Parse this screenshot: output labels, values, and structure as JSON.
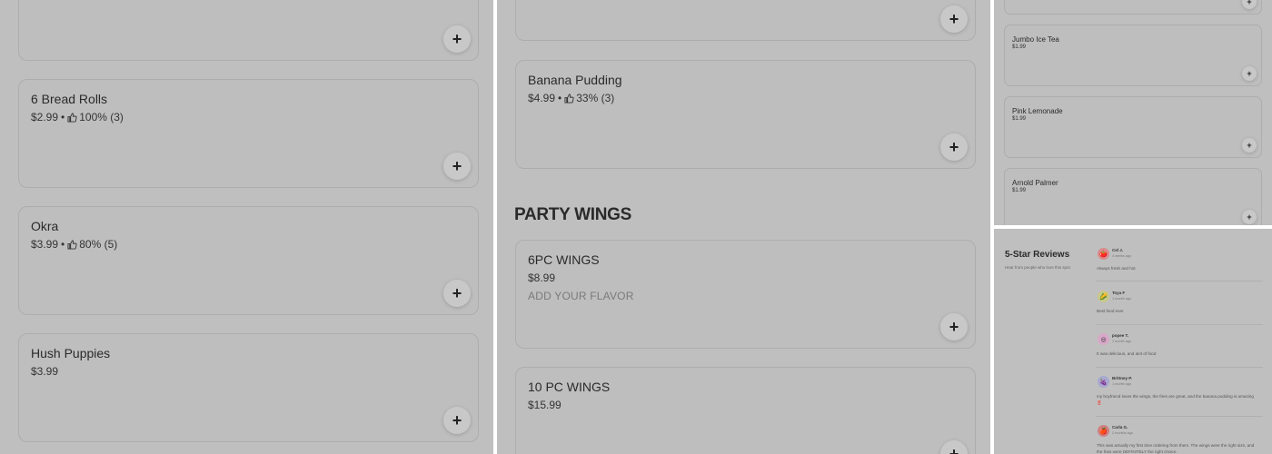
{
  "colors": {
    "panel_bg": "#bfbfbf",
    "card_border": "#adadad",
    "plus_bg": "#c8c8c8"
  },
  "panel1": {
    "items": [
      {
        "title": "",
        "price": ""
      },
      {
        "title": "6 Bread Rolls",
        "price": "$2.99",
        "rating": "100% (3)"
      },
      {
        "title": "Okra",
        "price": "$3.99",
        "rating": "80% (5)"
      },
      {
        "title": "Hush Puppies",
        "price": "$3.99"
      }
    ]
  },
  "panel2": {
    "items": [
      {
        "title": "",
        "price": ""
      },
      {
        "title": "Banana Pudding",
        "price": "$4.99",
        "rating": "33% (3)"
      }
    ],
    "section_title": "PARTY WINGS",
    "wings": [
      {
        "title": "6PC WINGS",
        "price": "$8.99",
        "extra": "ADD YOUR FLAVOR"
      },
      {
        "title": "10 PC WINGS",
        "price": "$15.99"
      }
    ]
  },
  "panel3": {
    "items": [
      {
        "title": "Jumbo Ice Tea",
        "price": "$1.99"
      },
      {
        "title": "Pink Lemonade",
        "price": "$1.99"
      },
      {
        "title": "Arnold Palmer",
        "price": "$1.99"
      }
    ]
  },
  "reviews": {
    "title": "5-Star Reviews",
    "subtitle": "Hear from people who love this spot",
    "items": [
      {
        "name": "Cel J.",
        "time": "4 weeks ago",
        "text": "Always fresh and hot",
        "avatar": "🍅",
        "avatar_bg": "#d98a8a"
      },
      {
        "name": "Toya F",
        "time": "1 month ago",
        "text": "Best food ever",
        "avatar": "🌽",
        "avatar_bg": "#c8c88a"
      },
      {
        "name": "popee T.",
        "time": "1 month ago",
        "text": "It was delicious, and alot of food",
        "avatar": "◎",
        "avatar_bg": "#d8a8c8"
      },
      {
        "name": "Brittney P.",
        "time": "1 month ago",
        "text": "my boyfriend loves the wings, the fries are great, and the banana pudding is amazing ‼️",
        "avatar": "🍇",
        "avatar_bg": "#a8a8d0"
      },
      {
        "name": "Carla G.",
        "time": "2 months ago",
        "text": "This was actually my first time ordering from them. The wings were the right size, and the fries were DEFINITELY the right choice.",
        "avatar": "🍎",
        "avatar_bg": "#d08080"
      }
    ]
  }
}
